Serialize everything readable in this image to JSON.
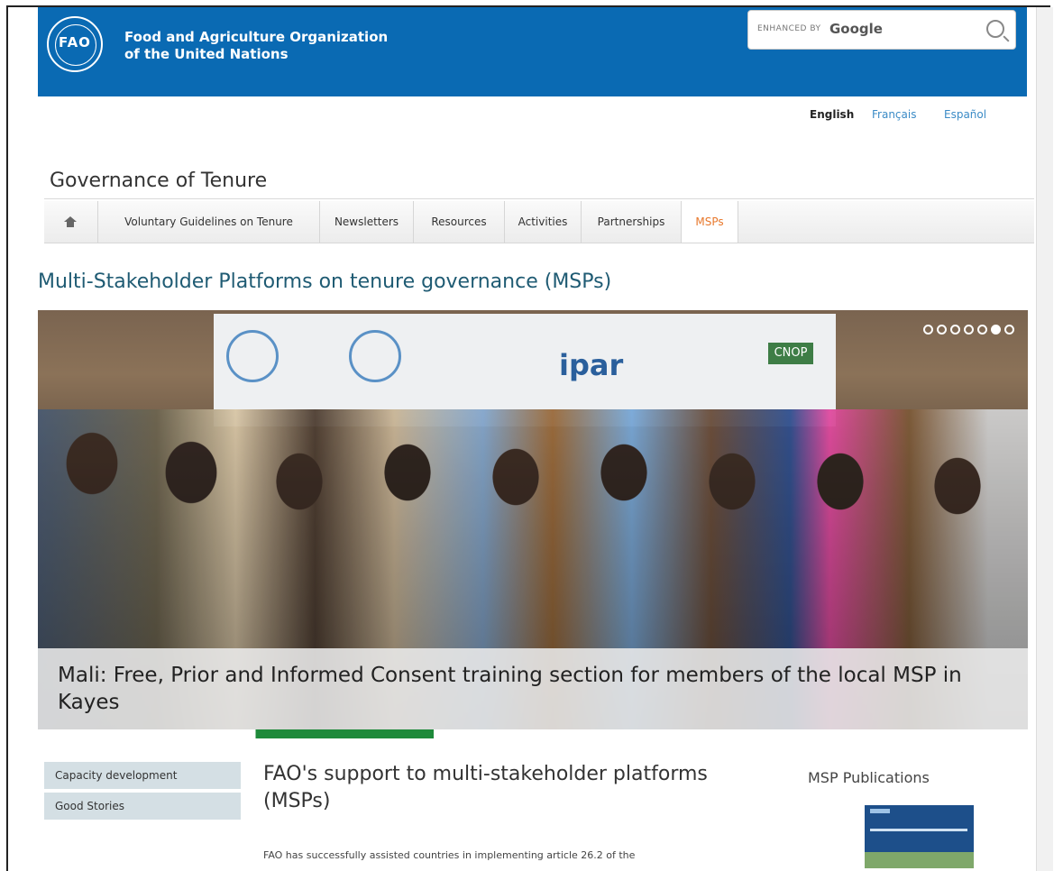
{
  "header": {
    "logo_text": "FAO",
    "org_line1": "Food and Agriculture Organization",
    "org_line2": "of the United Nations",
    "search": {
      "enhanced_by": "ENHANCED BY",
      "brand": "Google",
      "icon": "search-icon"
    }
  },
  "languages": [
    "English",
    "Français",
    "Español"
  ],
  "site_title": "Governance of Tenure",
  "nav": {
    "home_icon": "home-icon",
    "items": [
      "Voluntary Guidelines on Tenure",
      "Newsletters",
      "Resources",
      "Activities",
      "Partnerships",
      "MSPs"
    ],
    "active": "MSPs"
  },
  "page_heading": "Multi-Stakeholder Platforms on tenure governance (MSPs)",
  "hero": {
    "banner_logo_text": "ipar",
    "banner_badge": "CNOP",
    "slides_total": 7,
    "active_slide": 6,
    "caption": "Mali: Free, Prior and Informed Consent training section for members of the local MSP in Kayes"
  },
  "side_menu": [
    "Capacity development",
    "Good Stories"
  ],
  "section": {
    "title": "FAO's support to multi-stakeholder platforms (MSPs)",
    "intro": "FAO has successfully assisted countries in implementing article 26.2 of the"
  },
  "publications": {
    "title": "MSP Publications"
  },
  "colors": {
    "header_blue": "#0a6ab3",
    "accent_orange": "#e8782c",
    "heading_teal": "#1f5b73",
    "link_blue": "#3b8bc6"
  }
}
